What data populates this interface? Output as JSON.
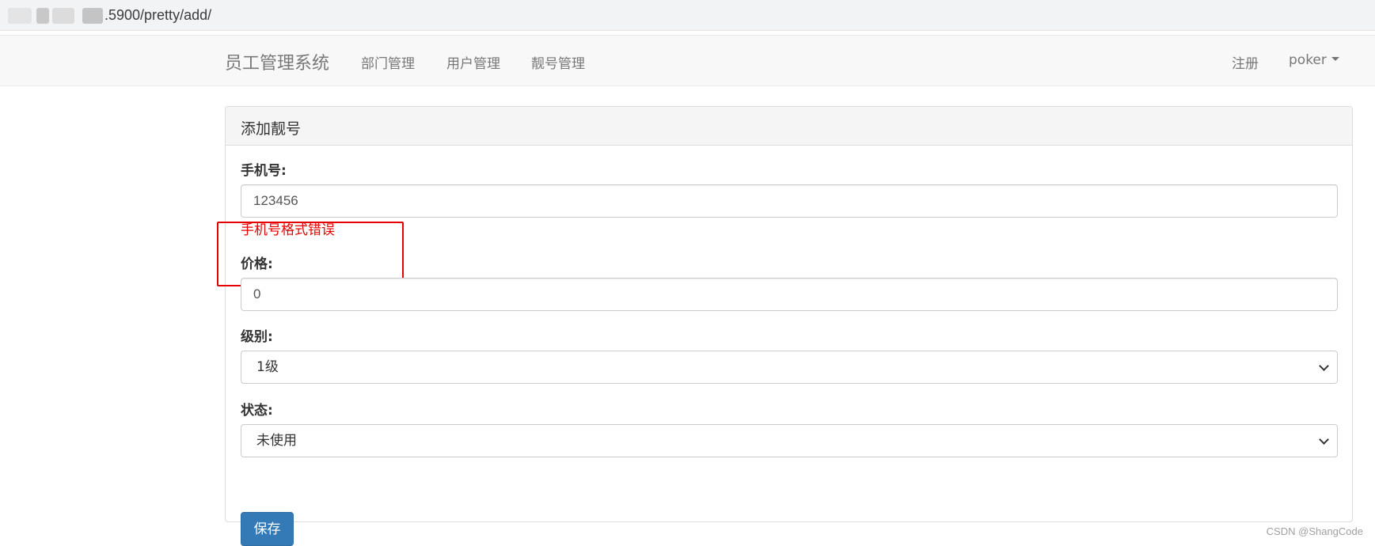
{
  "browser": {
    "address": ".5900/pretty/add/"
  },
  "navbar": {
    "brand": "员工管理系统",
    "links": [
      {
        "label": "部门管理"
      },
      {
        "label": "用户管理"
      },
      {
        "label": "靓号管理"
      }
    ],
    "right": {
      "register": "注册",
      "account": "poker"
    }
  },
  "panel": {
    "heading": "添加靓号",
    "fields": {
      "mobile": {
        "label": "手机号:",
        "value": "123456",
        "error": "手机号格式错误"
      },
      "price": {
        "label": "价格:",
        "value": "0"
      },
      "level": {
        "label": "级别:",
        "selected": "1级"
      },
      "status": {
        "label": "状态:",
        "selected": "未使用"
      }
    },
    "save_label": "保存"
  },
  "watermark": "CSDN @ShangCode",
  "colors": {
    "primary": "#337ab7",
    "error": "#e60000",
    "navbar_bg": "#f8f8f8",
    "panel_heading_bg": "#f5f5f5"
  }
}
